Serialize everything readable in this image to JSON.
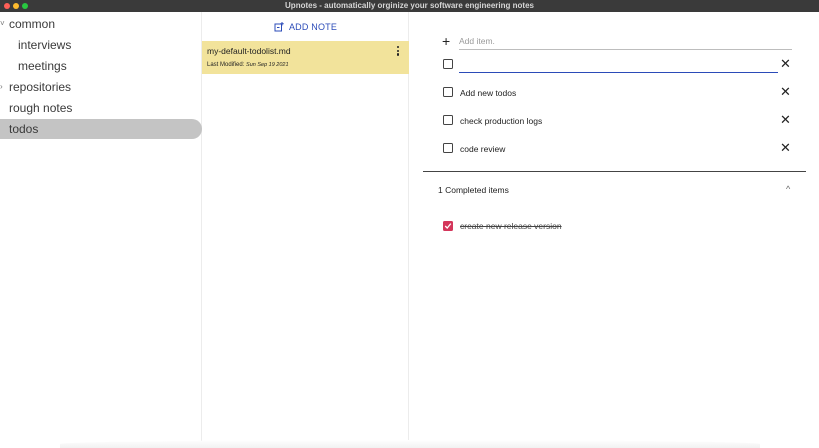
{
  "window": {
    "title": "Upnotes - automatically orginize your software engineering notes"
  },
  "sidebar": {
    "items": [
      {
        "label": "common",
        "expanded": true
      },
      {
        "label": "interviews"
      },
      {
        "label": "meetings"
      },
      {
        "label": "repositories",
        "expanded": false
      },
      {
        "label": "rough notes"
      },
      {
        "label": "todos",
        "selected": true
      }
    ]
  },
  "notes_list": {
    "add_note_label": "ADD NOTE",
    "notes": [
      {
        "name": "my-default-todolist.md",
        "modified_label": "Last Modified:",
        "modified_date": "Sun Sep 19 2021"
      }
    ]
  },
  "editor": {
    "add_item_placeholder": "Add item.",
    "new_item_value": "",
    "todos": [
      {
        "label": "Add new todos",
        "checked": false
      },
      {
        "label": "check production logs",
        "checked": false
      },
      {
        "label": "code review",
        "checked": false
      }
    ],
    "completed_header": "1 Completed items",
    "completed": [
      {
        "label": "create new release version",
        "checked": true
      }
    ]
  },
  "colors": {
    "selected_note": "#f2e39b",
    "accent": "#2b4bb8",
    "checked": "#d4365b",
    "selected_folder": "#c4c4c4"
  },
  "icons": {
    "add_note": "note-add-icon",
    "more": "kebab-menu-icon",
    "add_item": "plus-icon",
    "delete": "close-icon",
    "collapse": "chevron-up-icon"
  }
}
